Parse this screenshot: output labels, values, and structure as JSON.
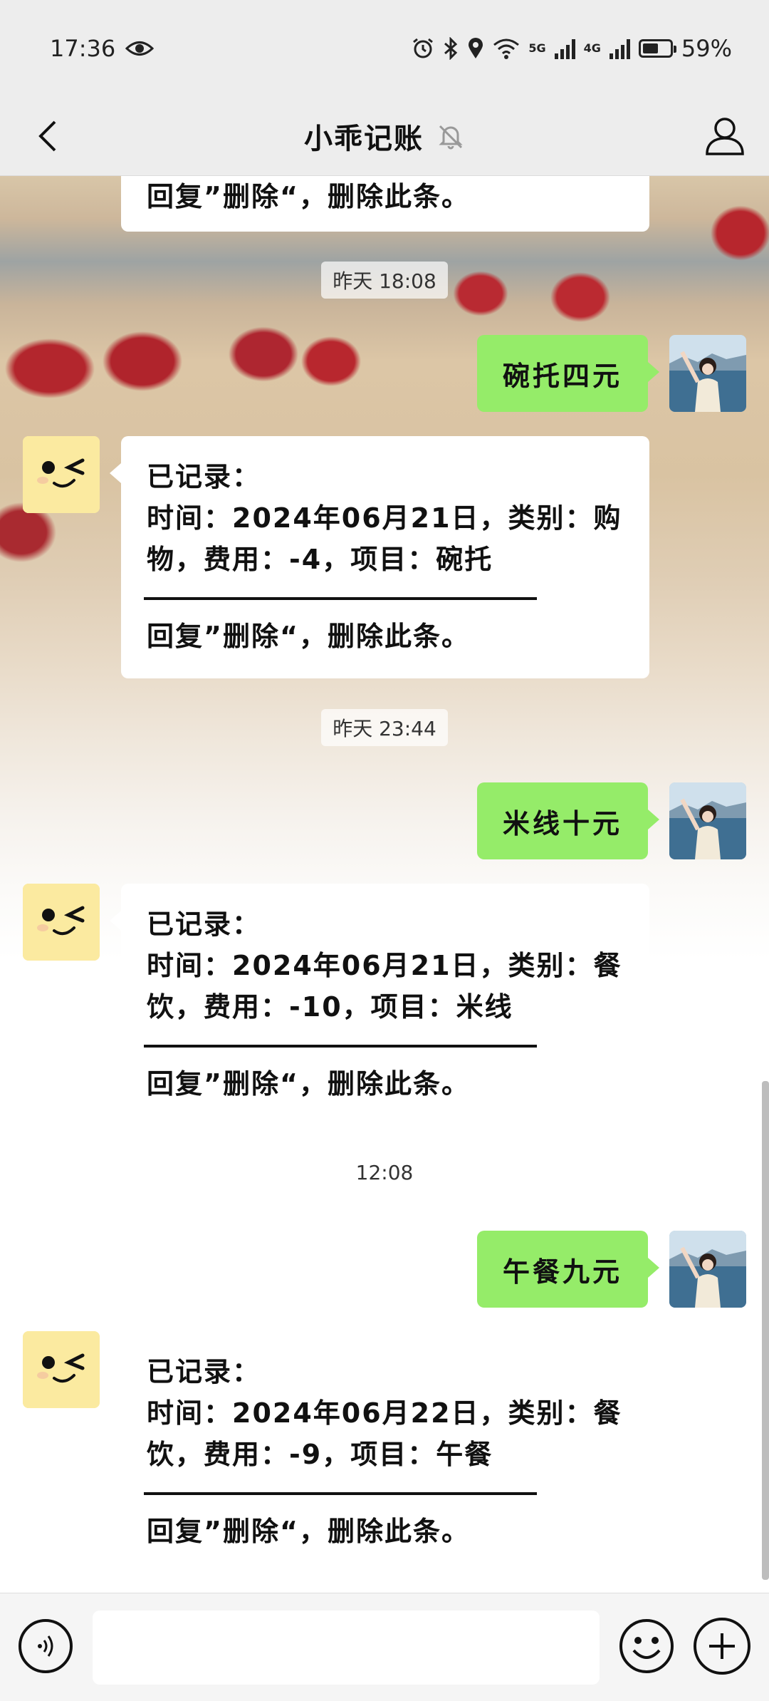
{
  "status_bar": {
    "time": "17:36",
    "battery": "59%",
    "battery_level": 0.59,
    "network_1": "5G",
    "network_2": "4G",
    "icons": [
      "eye-icon",
      "alarm-icon",
      "bluetooth-icon",
      "location-icon",
      "wifi-icon",
      "signal-icon",
      "battery-icon"
    ]
  },
  "header": {
    "title": "小乖记账",
    "icons": [
      "back-icon",
      "mute-bell-icon",
      "profile-icon"
    ]
  },
  "messages": {
    "partial_top": {
      "reply_hint": "回复”删除“，删除此条。"
    },
    "ts1": "昨天 18:08",
    "m1_user": "碗托四元",
    "m1_bot": {
      "line1": "已记录：",
      "line2": "时间：2024年06月21日，类别：购物，费用：-4，项目：碗托",
      "reply_hint": "回复”删除“，删除此条。"
    },
    "ts2": "昨天 23:44",
    "m2_user": "米线十元",
    "m2_bot": {
      "line1": "已记录：",
      "line2": "时间：2024年06月21日，类别：餐饮，费用：-10，项目：米线",
      "reply_hint": "回复”删除“，删除此条。"
    },
    "ts3": "12:08",
    "m3_user": "午餐九元",
    "m3_bot": {
      "line1": "已记录：",
      "line2": "时间：2024年06月22日，类别：餐饮，费用：-9，项目：午餐",
      "reply_hint": "回复”删除“，删除此条。"
    }
  },
  "input_bar": {
    "input_value": "",
    "icons": [
      "voice-icon",
      "emoji-icon",
      "plus-icon"
    ]
  },
  "colors": {
    "user_bubble": "#95ec69",
    "bot_bubble": "#ffffff",
    "bar_bg": "#ededed"
  }
}
